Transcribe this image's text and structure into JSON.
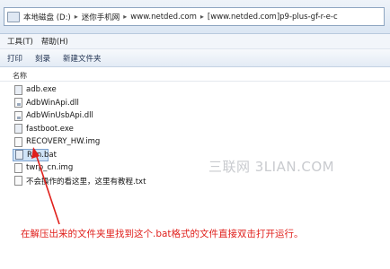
{
  "address_bar": {
    "crumbs": [
      "本地磁盘 (D:)",
      "迷你手机网",
      "www.netded.com",
      "[www.netded.com]p9-plus-gf-r-e-c"
    ]
  },
  "menu": {
    "items": [
      "工具(T)",
      "帮助(H)"
    ]
  },
  "toolbar": {
    "buttons": [
      "打印",
      "刻录",
      "新建文件夹"
    ]
  },
  "column_header": "名称",
  "files": [
    {
      "name": "adb.exe",
      "icon": "exe-file-icon"
    },
    {
      "name": "AdbWinApi.dll",
      "icon": "dll-file-icon"
    },
    {
      "name": "AdbWinUsbApi.dll",
      "icon": "dll-file-icon"
    },
    {
      "name": "fastboot.exe",
      "icon": "exe-file-icon"
    },
    {
      "name": "RECOVERY_HW.img",
      "icon": "img-file-icon"
    },
    {
      "name": "Run.bat",
      "icon": "bat-file-icon",
      "selected": true
    },
    {
      "name": "twrp_cn.img",
      "icon": "img-file-icon"
    },
    {
      "name": "不会操作的看这里，这里有教程.txt",
      "icon": "txt-file-icon"
    }
  ],
  "watermark": "三联网 3LIAN.COM",
  "annotation": "在解压出来的文件夹里找到这个.bat格式的文件直接双击打开运行。",
  "colors": {
    "annotation": "#e0201c",
    "selection": "#cfe3f7",
    "arrow": "#e0201c"
  }
}
